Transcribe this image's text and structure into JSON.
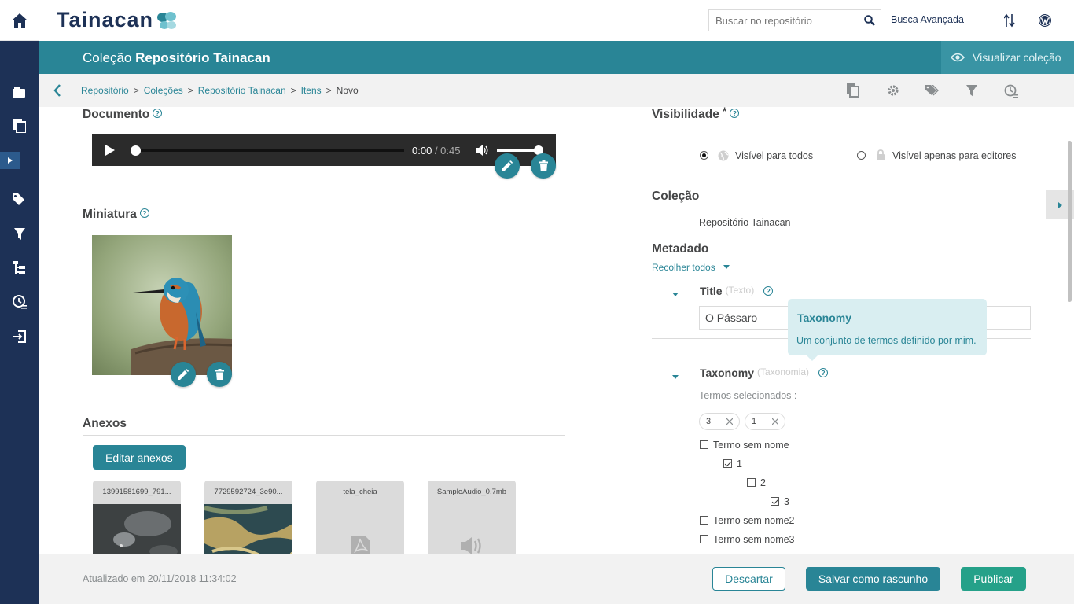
{
  "brand": {
    "logo_text": "Tainacan"
  },
  "search": {
    "placeholder": "Buscar no repositório",
    "advanced_label": "Busca Avançada"
  },
  "collection_bar": {
    "prefix": "Coleção",
    "name": "Repositório Tainacan",
    "view_label": "Visualizar coleção"
  },
  "breadcrumb": {
    "items": [
      "Repositório",
      "Coleções",
      "Repositório Tainacan",
      "Itens"
    ],
    "current": "Novo",
    "separator": ">"
  },
  "document": {
    "label": "Documento",
    "help": "?",
    "audio": {
      "current_time": "0:00",
      "duration": "/ 0:45",
      "progress": 0.0,
      "volume": 0.9
    }
  },
  "thumbnail": {
    "label": "Miniatura",
    "help": "?"
  },
  "attachments": {
    "label": "Anexos",
    "edit_button": "Editar anexos",
    "items": [
      {
        "name": "13991581699_791...",
        "type": "image-dark"
      },
      {
        "name": "7729592724_3e90...",
        "type": "image-map"
      },
      {
        "name": "tela_cheia",
        "type": "pdf"
      },
      {
        "name": "SampleAudio_0.7mb",
        "type": "audio"
      }
    ]
  },
  "visibility": {
    "label": "Visibilidade",
    "required_mark": "*",
    "options": [
      {
        "label": "Visível para todos",
        "selected": true,
        "icon": "globe-icon"
      },
      {
        "label": "Visível apenas para editores",
        "selected": false,
        "icon": "lock-icon"
      }
    ]
  },
  "collection": {
    "label": "Coleção",
    "value": "Repositório Tainacan"
  },
  "metadata": {
    "label": "Metadado",
    "collapse_all": "Recolher todos",
    "title_field": {
      "name": "Title",
      "type": "(Texto)",
      "value": "O Pássaro"
    },
    "taxonomy_field": {
      "name": "Taxonomy",
      "type": "(Taxonomia)",
      "selected_label": "Termos selecionados :",
      "selected_tags": [
        "3",
        "1"
      ],
      "terms": [
        {
          "label": "Termo sem nome",
          "checked": false,
          "level": 0
        },
        {
          "label": "1",
          "checked": true,
          "level": 1
        },
        {
          "label": "2",
          "checked": false,
          "level": 2
        },
        {
          "label": "3",
          "checked": true,
          "level": 3
        },
        {
          "label": "Termo sem nome2",
          "checked": false,
          "level": 0
        },
        {
          "label": "Termo sem nome3",
          "checked": false,
          "level": 0
        }
      ]
    }
  },
  "tooltip": {
    "title": "Taxonomy",
    "body": "Um conjunto de termos definido por mim."
  },
  "footer": {
    "updated": "Atualizado em 20/11/2018 11:34:02",
    "discard": "Descartar",
    "save_draft": "Salvar como rascunho",
    "publish": "Publicar"
  },
  "colors": {
    "primary": "#298596",
    "sidebar": "#1d3156",
    "publish": "#25a189",
    "tooltip_bg": "#d9eef1"
  }
}
